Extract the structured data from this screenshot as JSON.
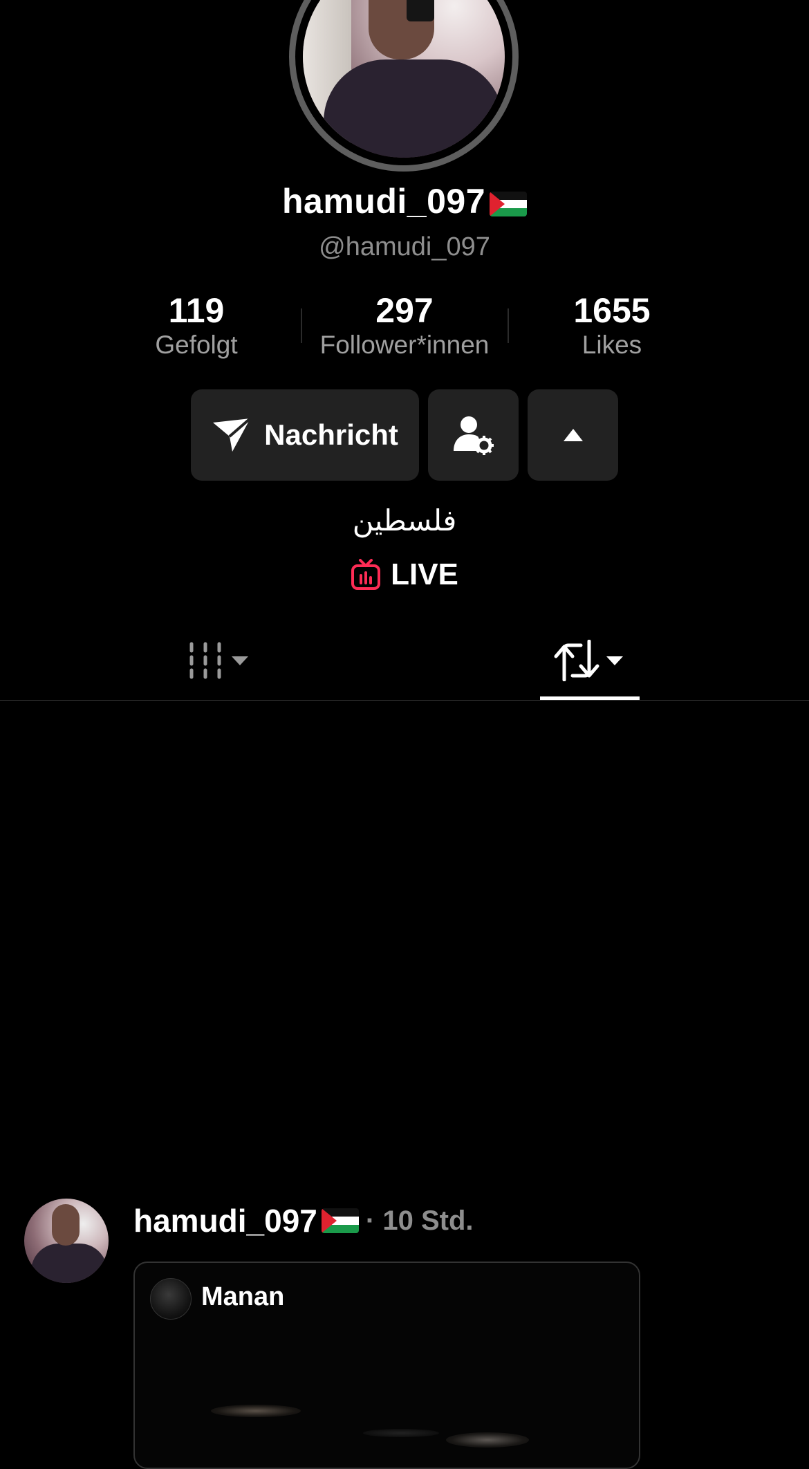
{
  "profile": {
    "display_name": "hamudi_097",
    "handle": "@hamudi_097",
    "bio": "فلسطين",
    "live_label": "LIVE"
  },
  "stats": [
    {
      "value": "119",
      "label": "Gefolgt"
    },
    {
      "value": "297",
      "label": "Follower*innen"
    },
    {
      "value": "1655",
      "label": "Likes"
    }
  ],
  "actions": {
    "message_label": "Nachricht"
  },
  "tabs": {
    "active": "reposts"
  },
  "post": {
    "author": "hamudi_097",
    "time": "· 10 Std.",
    "quoted_author": "Manan"
  },
  "colors": {
    "background": "#000000",
    "live_accent": "#fe2c55",
    "button_bg": "#222222"
  }
}
